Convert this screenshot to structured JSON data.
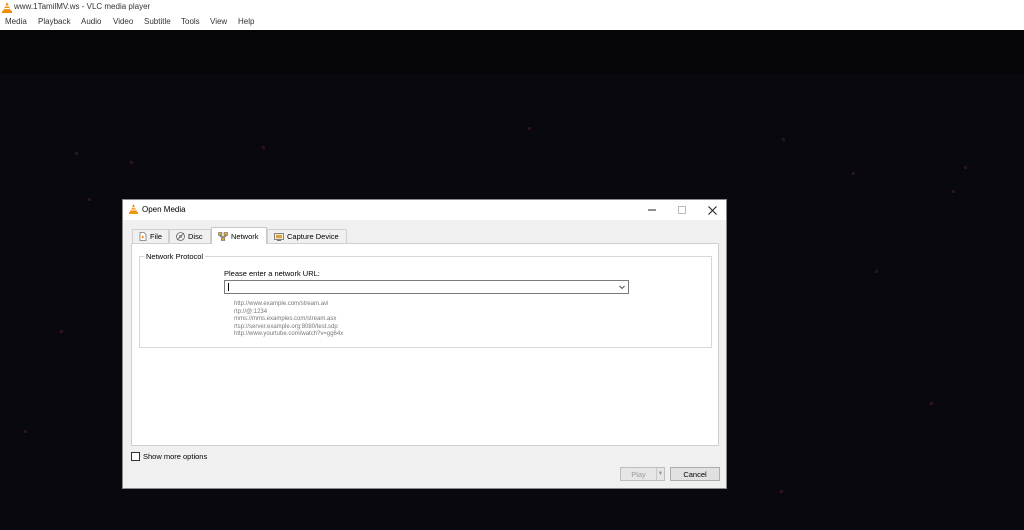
{
  "window": {
    "title": "www.1TamilMV.ws - VLC media player"
  },
  "menu": [
    {
      "label": "Media"
    },
    {
      "label": "Playback"
    },
    {
      "label": "Audio"
    },
    {
      "label": "Video"
    },
    {
      "label": "Subtitle"
    },
    {
      "label": "Tools"
    },
    {
      "label": "View"
    },
    {
      "label": "Help"
    }
  ],
  "dialog": {
    "title": "Open Media",
    "tabs": [
      {
        "label": "File",
        "icon": "file-icon"
      },
      {
        "label": "Disc",
        "icon": "disc-icon"
      },
      {
        "label": "Network",
        "icon": "network-icon",
        "active": true
      },
      {
        "label": "Capture Device",
        "icon": "capture-device-icon"
      }
    ],
    "network": {
      "group_title": "Network Protocol",
      "prompt": "Please enter a network URL:",
      "url_value": "",
      "examples": [
        "http://www.example.com/stream.avi",
        "rtp://@:1234",
        "mms://mms.examples.com/stream.asx",
        "rtsp://server.example.org:8080/test.sdp",
        "http://www.yourtube.com/watch?v=gg64x"
      ]
    },
    "show_more_options": {
      "label": "Show more options",
      "checked": false
    },
    "buttons": {
      "play": "Play",
      "cancel": "Cancel"
    }
  },
  "colors": {
    "vlc_orange": "#f08c00",
    "video_background": "#050508"
  }
}
